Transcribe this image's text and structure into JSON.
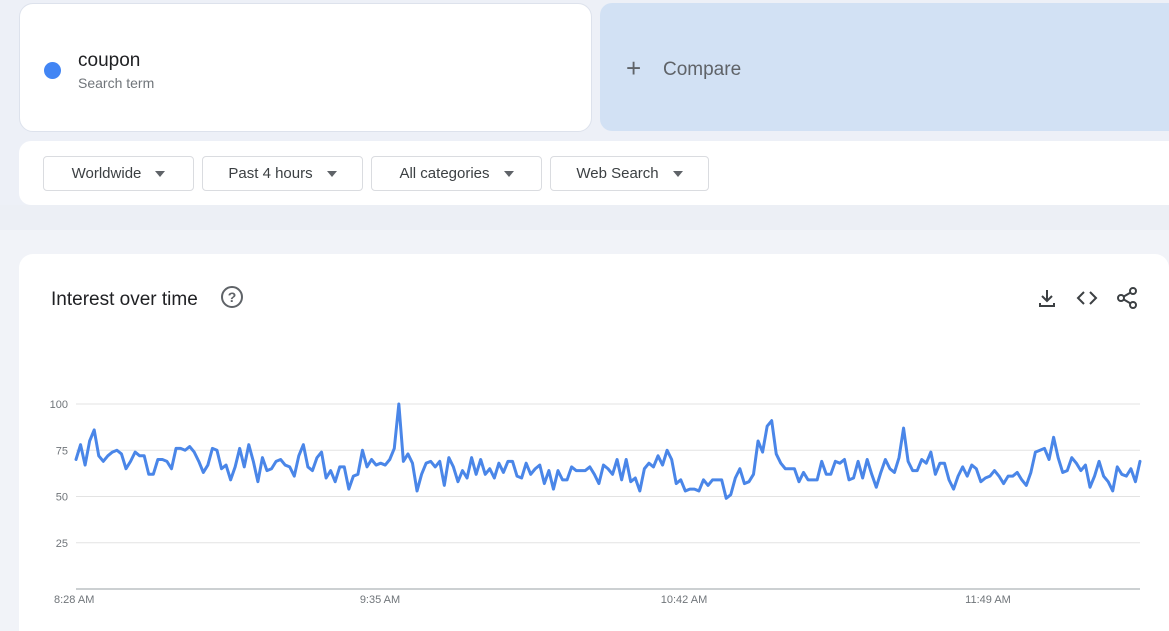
{
  "search_term": {
    "name": "coupon",
    "subtitle": "Search term",
    "color": "#4285f4"
  },
  "compare": {
    "plus": "+",
    "label": "Compare"
  },
  "filters": {
    "region": "Worldwide",
    "time": "Past 4 hours",
    "category": "All categories",
    "search_type": "Web Search"
  },
  "panel": {
    "title": "Interest over time",
    "help": "?",
    "icons": [
      "download-icon",
      "embed-code-icon",
      "share-icon"
    ]
  },
  "chart_data": {
    "type": "line",
    "title": "",
    "xlabel": "",
    "ylabel": "",
    "ylim": [
      0,
      100
    ],
    "y_ticks": [
      25,
      50,
      75,
      100
    ],
    "x_ticks": [
      "8:28 AM",
      "9:35 AM",
      "10:42 AM",
      "11:49 AM"
    ],
    "grid": true,
    "series": [
      {
        "color": "#4a86e8",
        "values": [
          70,
          78,
          67,
          80,
          86,
          72,
          69,
          72,
          74,
          75,
          73,
          65,
          69,
          74,
          72,
          72,
          62,
          62,
          70,
          70,
          69,
          65,
          76,
          76,
          75,
          77,
          74,
          69,
          63,
          67,
          76,
          75,
          65,
          67,
          59,
          66,
          76,
          66,
          78,
          69,
          58,
          71,
          64,
          65,
          69,
          70,
          67,
          66,
          61,
          72,
          78,
          66,
          64,
          71,
          74,
          60,
          64,
          58,
          66,
          66,
          54,
          61,
          62,
          75,
          66,
          70,
          67,
          68,
          67,
          70,
          76,
          100,
          69,
          73,
          68,
          53,
          62,
          68,
          69,
          66,
          69,
          56,
          71,
          66,
          58,
          64,
          60,
          71,
          62,
          70,
          62,
          65,
          60,
          68,
          63,
          69,
          69,
          61,
          60,
          68,
          62,
          65,
          67,
          57,
          64,
          54,
          64,
          59,
          59,
          66,
          64,
          64,
          64,
          66,
          62,
          57,
          67,
          65,
          62,
          70,
          59,
          70,
          58,
          60,
          53,
          65,
          68,
          66,
          72,
          67,
          75,
          70,
          57,
          59,
          53,
          54,
          54,
          53,
          59,
          56,
          59,
          59,
          59,
          49,
          51,
          60,
          65,
          57,
          58,
          62,
          80,
          74,
          88,
          91,
          73,
          68,
          65,
          65,
          65,
          58,
          63,
          59,
          59,
          59,
          69,
          62,
          62,
          69,
          68,
          70,
          59,
          60,
          69,
          60,
          70,
          62,
          55,
          63,
          70,
          65,
          63,
          71,
          87,
          69,
          64,
          64,
          70,
          68,
          74,
          62,
          68,
          68,
          59,
          54,
          61,
          66,
          61,
          67,
          65,
          58,
          60,
          61,
          64,
          61,
          57,
          61,
          61,
          63,
          59,
          56,
          63,
          74,
          75,
          76,
          70,
          82,
          71,
          63,
          64,
          71,
          68,
          64,
          67,
          55,
          61,
          69,
          61,
          58,
          53,
          66,
          62,
          61,
          65,
          58,
          69
        ]
      }
    ]
  }
}
